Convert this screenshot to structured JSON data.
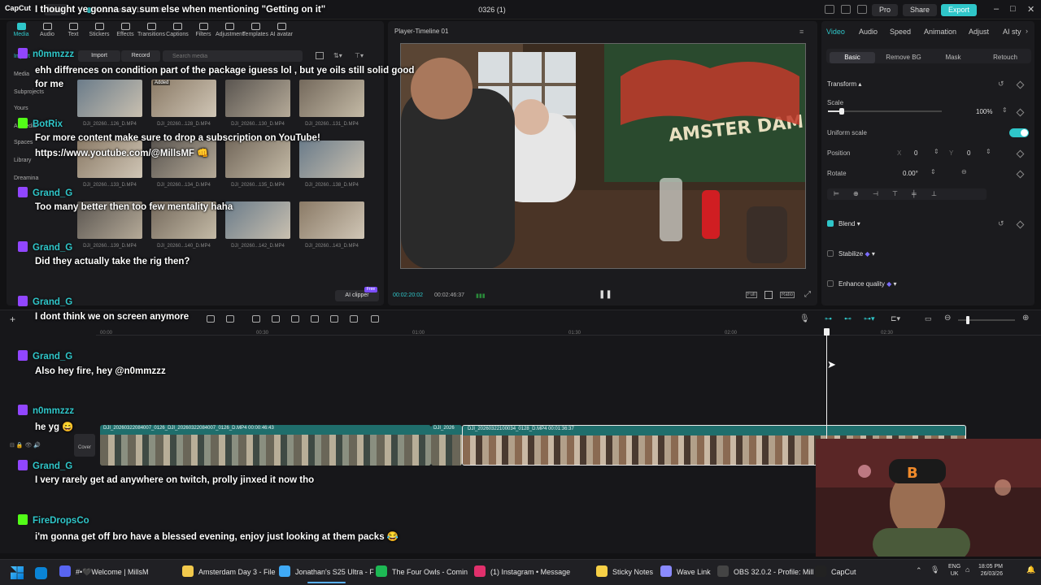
{
  "app": {
    "logo": "CapCut",
    "menu_label": "Menu",
    "autosave": "Auto saved: 18:04:49",
    "project_title": "0326 (1)",
    "pro_label": "Pro",
    "share_label": "Share",
    "export_label": "Export"
  },
  "toolbar_tabs": [
    "Media",
    "Audio",
    "Text",
    "Stickers",
    "Effects",
    "Transitions",
    "Captions",
    "Filters",
    "Adjustment",
    "Templates",
    "AI avatar"
  ],
  "media_sidebar": [
    "Import",
    "Media",
    "Subprojects",
    "Yours",
    "AI media",
    "Spaces",
    "Library",
    "Dreamina"
  ],
  "media_actions": {
    "import": "Import",
    "record": "Record",
    "search_placeholder": "Search media",
    "ai_clipper": "AI clipper",
    "free_badge": "Free",
    "added_badge": "Added"
  },
  "media_labels": [
    "DJI_20260...126_D.MP4",
    "DJI_20260...128_D.MP4",
    "DJI_20260...130_D.MP4",
    "DJI_20260...131_D.MP4",
    "DJI_20260...133_D.MP4",
    "DJI_20260...134_D.MP4",
    "DJI_20260...135_D.MP4",
    "DJI_20260...138_D.MP4",
    "DJI_20260...139_D.MP4",
    "DJI_20260...140_D.MP4",
    "DJI_20260...142_D.MP4",
    "DJI_20260...143_D.MP4"
  ],
  "player": {
    "title": "Player-Timeline 01",
    "current_time": "00:02:20:02",
    "total_time": "00:02:46:37",
    "full_label": "Full",
    "ratio_label": "Ratio"
  },
  "right_panel": {
    "tabs": [
      "Video",
      "Audio",
      "Speed",
      "Animation",
      "Adjust",
      "AI sty"
    ],
    "subtabs": [
      "Basic",
      "Remove BG",
      "Mask",
      "Retouch"
    ],
    "transform": "Transform",
    "scale_label": "Scale",
    "scale_value": "100%",
    "scale_fraction": 0.12,
    "uniform_scale": "Uniform scale",
    "position_label": "Position",
    "pos_x_label": "X",
    "pos_x": "0",
    "pos_y_label": "Y",
    "pos_y": "0",
    "rotate_label": "Rotate",
    "rotate_value": "0.00°",
    "blend": "Blend",
    "stabilize": "Stabilize",
    "enhance": "Enhance quality"
  },
  "timeline": {
    "ruler": [
      "00:00",
      "00:30",
      "01:00",
      "01:30",
      "02:00",
      "02:30"
    ],
    "clip1_label": "DJI_20260322084007_0126_DJI_20260322084007_0126_D.MP4  00:00:46:43",
    "clip2_small": "DJI_2026",
    "clip3_label": "DJI_20260322100034_0128_D.MP4  00:01:36:37",
    "cover_label": "Cover"
  },
  "chat": [
    {
      "platform": "none",
      "user": "",
      "msg": "I thought ye gonna say sum else when mentioning \"Getting on it\""
    },
    {
      "platform": "twitch",
      "user": "n0mmzzz",
      "msg": "ehh diffrences on condition part of the package iguess lol , but ye oils still solid good for me"
    },
    {
      "platform": "kick",
      "user": "BotRix",
      "msg": "For more content make sure to drop a subscription on YouTube!"
    },
    {
      "platform": "none",
      "user": "",
      "msg": "https://www.youtube.com/@MillsMF 👊"
    },
    {
      "platform": "twitch",
      "user": "Grand_G",
      "msg": "Too many better then too few mentality haha"
    },
    {
      "platform": "twitch",
      "user": "Grand_G",
      "msg": "Did they actually take the rig then?"
    },
    {
      "platform": "twitch",
      "user": "Grand_G",
      "msg": "I dont think we on screen anymore"
    },
    {
      "platform": "twitch",
      "user": "Grand_G",
      "msg": "Also hey fire, hey @n0mmzzz"
    },
    {
      "platform": "twitch",
      "user": "n0mmzzz",
      "msg": "he yg 😄"
    },
    {
      "platform": "twitch",
      "user": "Grand_G",
      "msg": "I very rarely get ad anywhere on twitch, prolly jinxed it now tho"
    },
    {
      "platform": "kick",
      "user": "FireDropsCo",
      "msg": "i'm gonna get off bro have a blessed evening, enjoy just looking at them packs 😂"
    }
  ],
  "taskbar": {
    "items": [
      {
        "label": "#•🖤Welcome | MillsM",
        "color": "#5865f2"
      },
      {
        "label": "Amsterdam Day 3 - File",
        "color": "#f2c94c"
      },
      {
        "label": "Jonathan's S25 Ultra - F",
        "color": "#3fa9f5"
      },
      {
        "label": "The Four Owls - Comin",
        "color": "#1db954"
      },
      {
        "label": "(1) Instagram • Message",
        "color": "#e1306c"
      },
      {
        "label": "Sticky Notes",
        "color": "#f7d046"
      },
      {
        "label": "Wave Link",
        "color": "#8a8aff"
      },
      {
        "label": "OBS 32.0.2 - Profile: Mill",
        "color": "#444444"
      },
      {
        "label": "CapCut",
        "color": "#222222"
      }
    ],
    "lang": "ENG",
    "region": "UK",
    "time": "18:05 PM",
    "date": "26/03/26"
  },
  "colors": {
    "accent": "#2fc6c9",
    "twitch": "#9146ff",
    "kick": "#53fc18"
  }
}
